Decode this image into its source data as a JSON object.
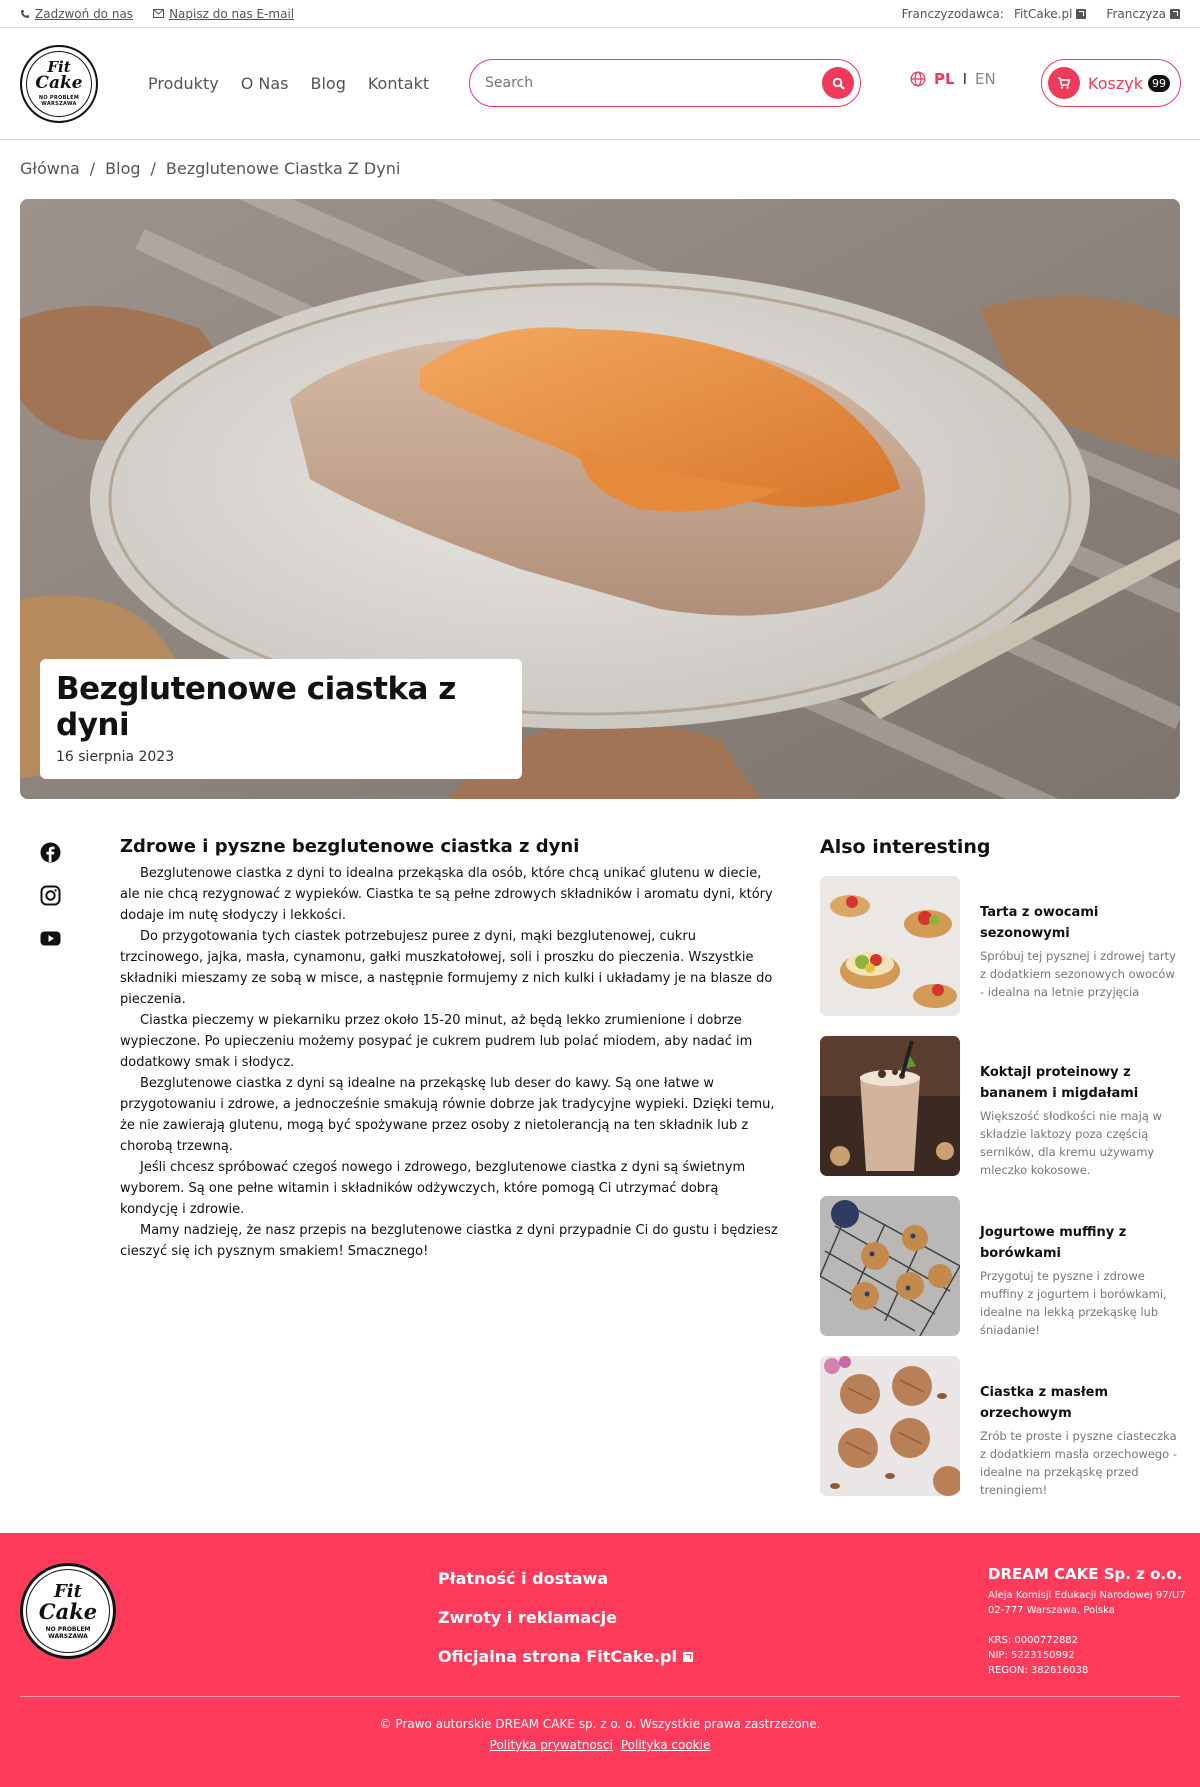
{
  "topbar": {
    "call": "Zadzwoń do nas",
    "email": "Napisz do nas E-mail",
    "franchisor_label": "Franczyzodawca:",
    "franchisor_link": "FitCake.pl",
    "franchisee": "Franczyza"
  },
  "logo": {
    "line1": "Fit",
    "line2": "Cake",
    "line3": "NO PROBLEM",
    "line4": "WARSZAWA"
  },
  "nav": [
    "Produkty",
    "O Nas",
    "Blog",
    "Kontakt"
  ],
  "search": {
    "placeholder": "Search"
  },
  "lang": {
    "pl": "PL",
    "sep": "I",
    "en": "EN"
  },
  "cart": {
    "label": "Koszyk",
    "count": "99"
  },
  "breadcrumb": [
    "Główna",
    "/",
    "Blog",
    "/",
    "Bezglutenowe Ciastka Z Dyni"
  ],
  "hero": {
    "title": "Bezglutenowe ciastka z dyni",
    "date": "16 sierpnia 2023"
  },
  "article": {
    "heading": "Zdrowe i pyszne bezglutenowe ciastka z dyni",
    "paragraphs": [
      "Bezglutenowe ciastka z dyni to idealna przekąska dla osób, które chcą unikać glutenu w diecie, ale nie chcą rezygnować z wypieków. Ciastka te są pełne zdrowych składników i aromatu dyni, który dodaje im nutę słodyczy i lekkości.",
      "Do przygotowania tych ciastek potrzebujesz puree z dyni, mąki bezglutenowej, cukru trzcinowego, jajka, masła, cynamonu, gałki muszkatołowej, soli i proszku do pieczenia. Wszystkie składniki mieszamy ze sobą w misce, a następnie formujemy z nich kulki i układamy je na blasze do pieczenia.",
      "Ciastka pieczemy w piekarniku przez około 15-20 minut, aż będą lekko zrumienione i dobrze wypieczone. Po upieczeniu możemy posypać je cukrem pudrem lub polać miodem, aby nadać im dodatkowy smak i słodycz.",
      "Bezglutenowe ciastka z dyni są idealne na przekąskę lub deser do kawy. Są one łatwe w przygotowaniu i zdrowe, a jednocześnie smakują równie dobrze jak tradycyjne wypieki. Dzięki temu, że nie zawierają glutenu, mogą być spożywane przez osoby z nietolerancją na ten składnik lub z chorobą trzewną.",
      "Jeśli chcesz spróbować czegoś nowego i zdrowego, bezglutenowe ciastka z dyni są świetnym wyborem. Są one pełne witamin i składników odżywczych, które pomogą Ci utrzymać dobrą kondycję i zdrowie.",
      "Mamy nadzieję, że nasz przepis na bezglutenowe ciastka z dyni przypadnie Ci do gustu i będziesz cieszyć się ich pysznym smakiem! Smacznego!"
    ]
  },
  "sidebar": {
    "title": "Also interesting",
    "items": [
      {
        "title": "Tarta z owocami sezonowymi",
        "desc": "Spróbuj tej pysznej i zdrowej tarty z dodatkiem sezonowych owoców - idealna na letnie przyjęcia"
      },
      {
        "title": "Koktajl proteinowy z bananem i migdałami",
        "desc": "Większość słodkości nie mają w składzie laktozy poza częścią serników, dla kremu używamy mleczko kokosowe."
      },
      {
        "title": "Jogurtowe muffiny z borówkami",
        "desc": "Przygotuj te pyszne i zdrowe muffiny z jogurtem i borówkami, idealne na lekką przekąskę lub śniadanie!"
      },
      {
        "title": "Ciastka z masłem orzechowym",
        "desc": "Zrób te proste i pyszne ciasteczka z dodatkiem masła orzechowego - idealne na przekąskę przed treningiem!"
      }
    ]
  },
  "footer": {
    "links": [
      "Płatność i dostawa",
      "Zwroty i reklamacje",
      "Oficjalna strona FitCake.pl"
    ],
    "company": {
      "name": "DREAM CAKE Sp. z o.o.",
      "address1": "Aleja Komisji Edukacji Narodowej 97/U7",
      "address2": "02-777 Warszawa, Polska",
      "krs": "KRS: 0000772882",
      "nip": "NIP: 5223150992",
      "regon": "REGON: 382616038"
    },
    "copyright": "© Prawo autorskie DREAM CAKE sp. z o. o. Wszystkie prawa zastrzeżone.",
    "privacy": "Polityka prywatnosci",
    "cookie": "Polityka cookie"
  },
  "colors": {
    "accent": "#ee3a5b",
    "footer_bg": "#ff3b5c",
    "text": "#111111",
    "muted": "#777777"
  },
  "icons": [
    "phone-icon",
    "mail-icon",
    "external-link-icon",
    "search-icon",
    "globe-icon",
    "cart-icon",
    "facebook-icon",
    "instagram-icon",
    "youtube-icon"
  ]
}
